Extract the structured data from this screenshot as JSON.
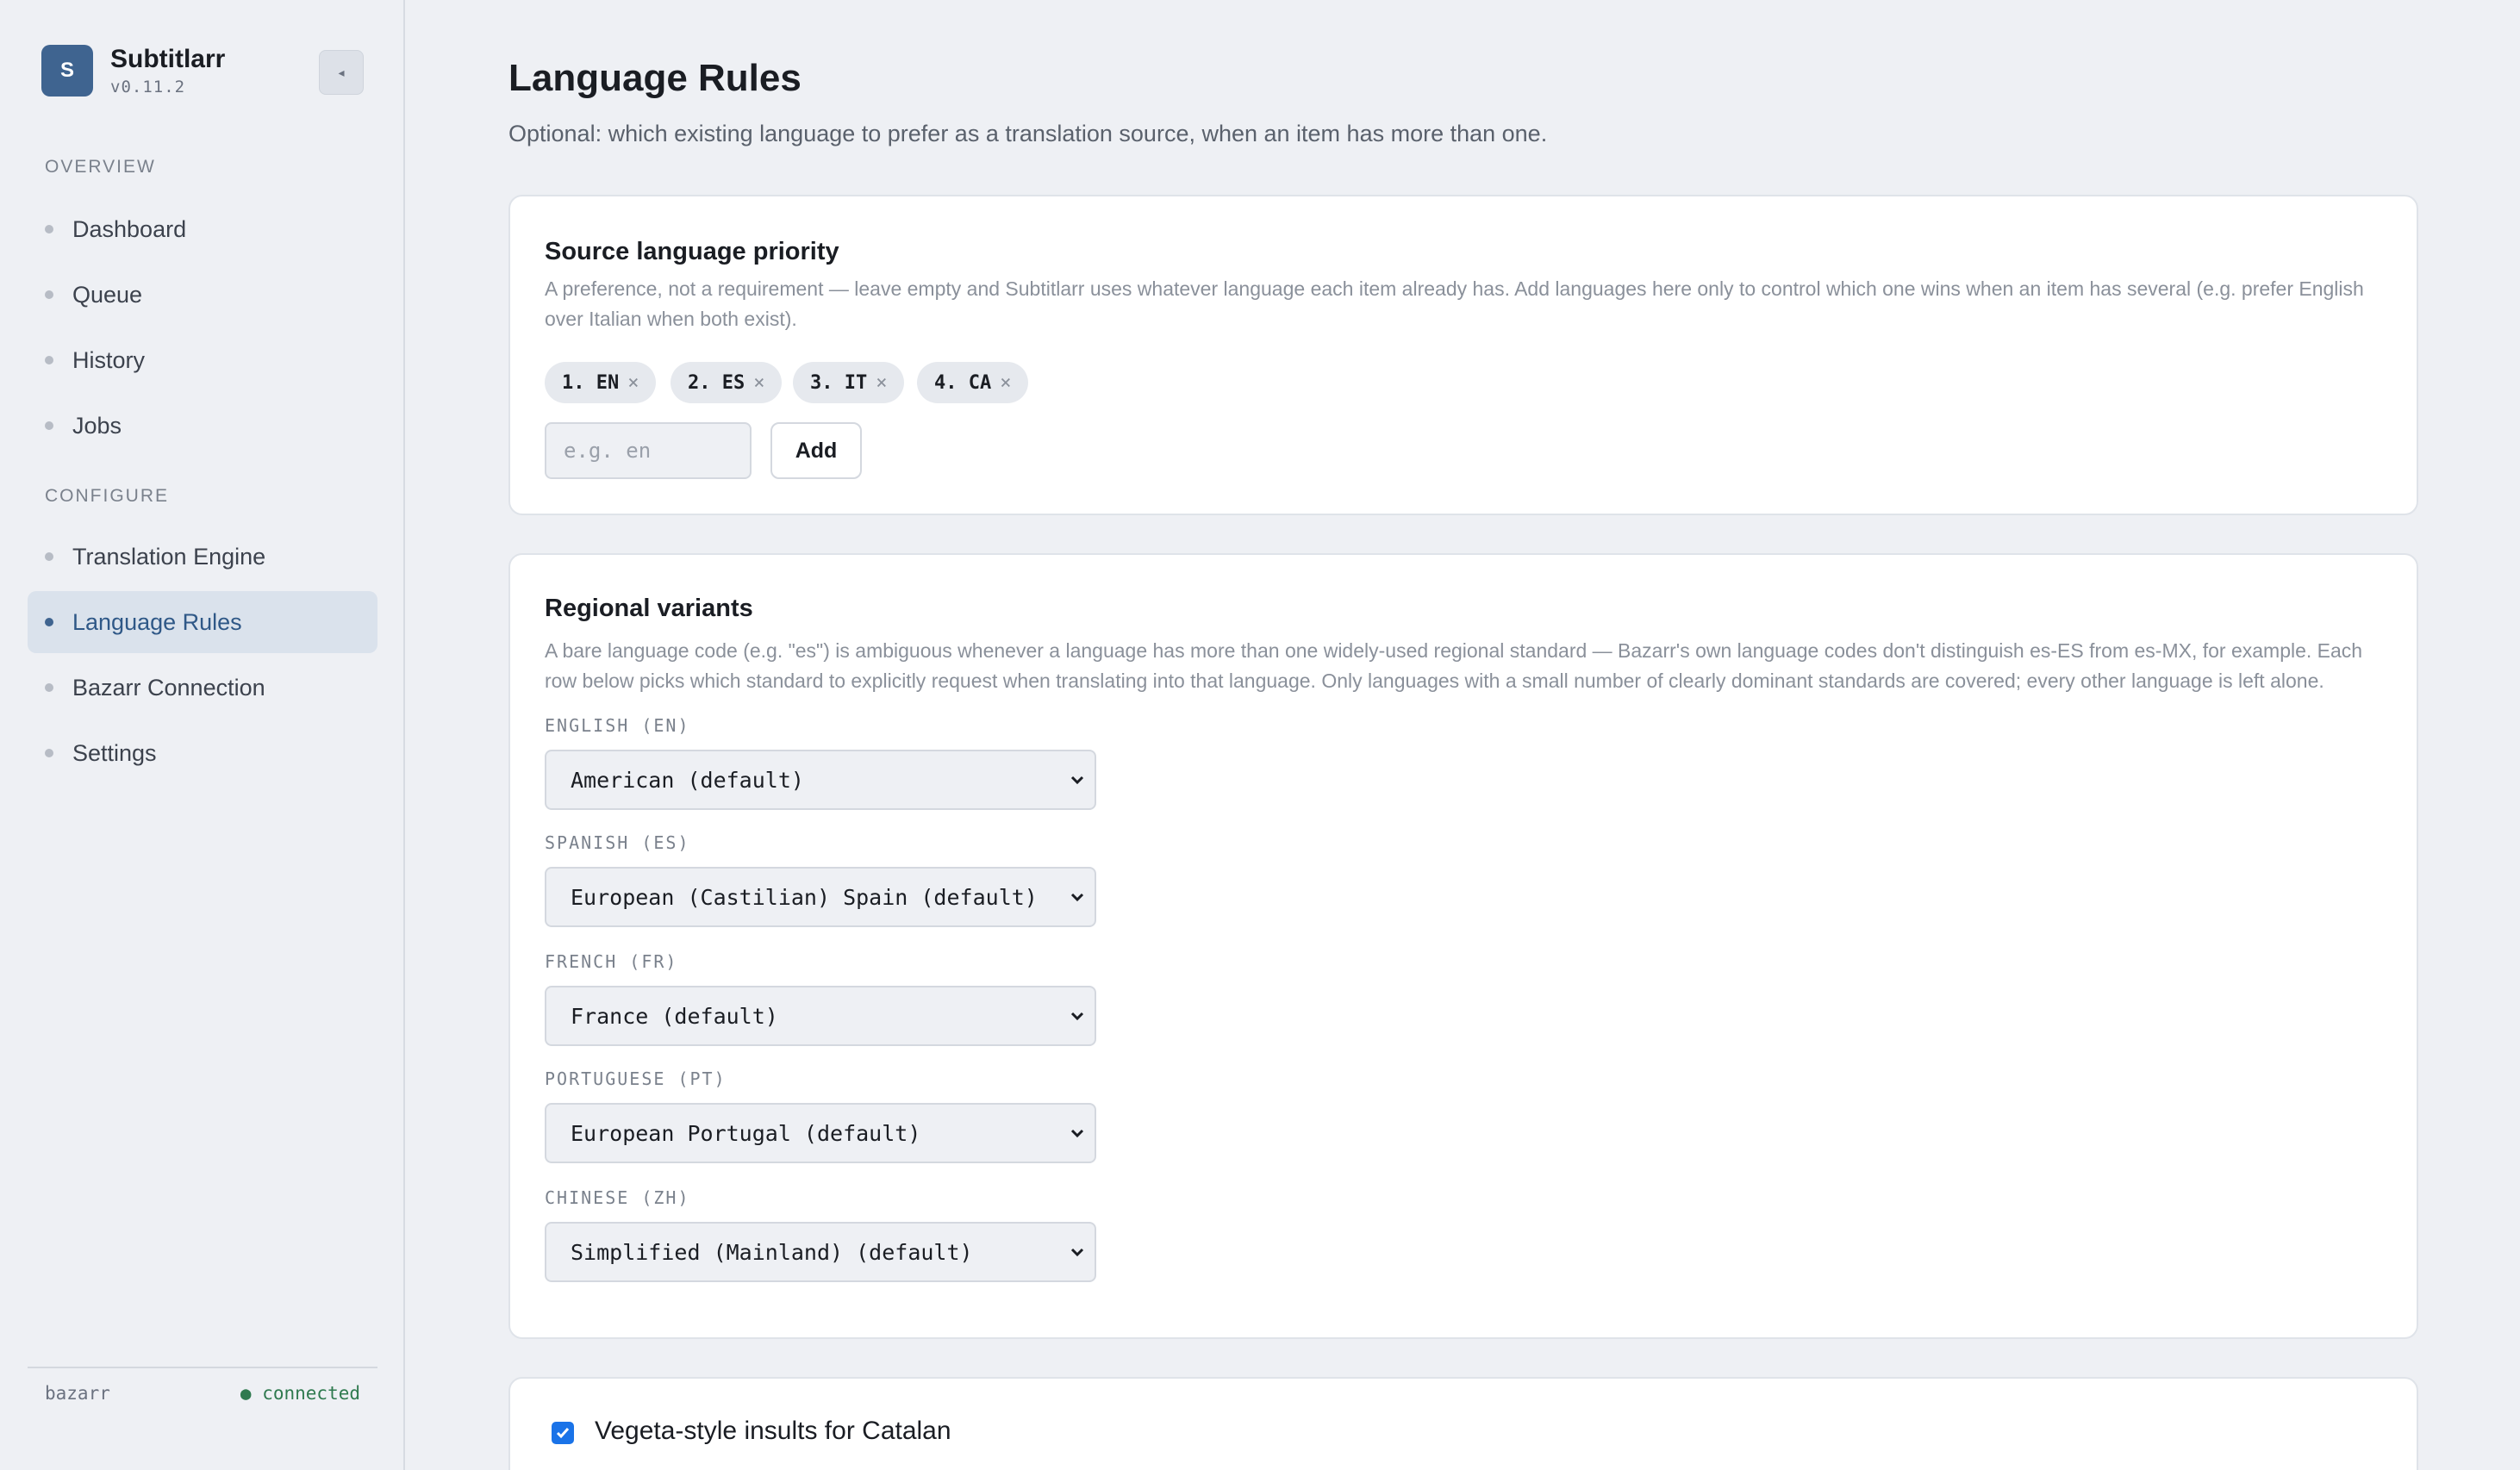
{
  "app": {
    "name": "Subtitlarr",
    "version": "v0.11.2",
    "logo_letter": "S"
  },
  "sidebar": {
    "sections": [
      {
        "label": "OVERVIEW",
        "items": [
          {
            "label": "Dashboard"
          },
          {
            "label": "Queue"
          },
          {
            "label": "History"
          },
          {
            "label": "Jobs"
          }
        ]
      },
      {
        "label": "CONFIGURE",
        "items": [
          {
            "label": "Translation Engine"
          },
          {
            "label": "Language Rules",
            "active": true
          },
          {
            "label": "Bazarr Connection"
          },
          {
            "label": "Settings"
          }
        ]
      }
    ],
    "footer": {
      "name": "bazarr",
      "status": "● connected"
    }
  },
  "page": {
    "title": "Language Rules",
    "subtitle": "Optional: which existing language to prefer as a translation source, when an item has more than one."
  },
  "source_priority": {
    "title": "Source language priority",
    "description": "A preference, not a requirement — leave empty and Subtitlarr uses whatever language each item already has. Add languages here only to control which one wins when an item has several (e.g. prefer English over Italian when both exist).",
    "chips": [
      "1. EN",
      "2. ES",
      "3. IT",
      "4. CA"
    ],
    "input_placeholder": "e.g. en",
    "input_value": "",
    "add_label": "Add"
  },
  "regional_variants": {
    "title": "Regional variants",
    "description": "A bare language code (e.g. \"es\") is ambiguous whenever a language has more than one widely-used regional standard — Bazarr's own language codes don't distinguish es-ES from es-MX, for example. Each row below picks which standard to explicitly request when translating into that language. Only languages with a small number of clearly dominant standards are covered; every other language is left alone.",
    "rows": [
      {
        "label": "ENGLISH (EN)",
        "selected": "American (default)"
      },
      {
        "label": "SPANISH (ES)",
        "selected": "European (Castilian) Spain (default)"
      },
      {
        "label": "FRENCH (FR)",
        "selected": "France (default)"
      },
      {
        "label": "PORTUGUESE (PT)",
        "selected": "European Portugal (default)"
      },
      {
        "label": "CHINESE (ZH)",
        "selected": "Simplified (Mainland) (default)"
      }
    ]
  },
  "insults": {
    "label": "Vegeta-style insults for Catalan",
    "checked": true
  },
  "colors": {
    "accent": "#3f6490",
    "active_nav_bg": "#dae2ec",
    "connected": "#2f7a4f",
    "checkbox": "#1a73e8"
  }
}
